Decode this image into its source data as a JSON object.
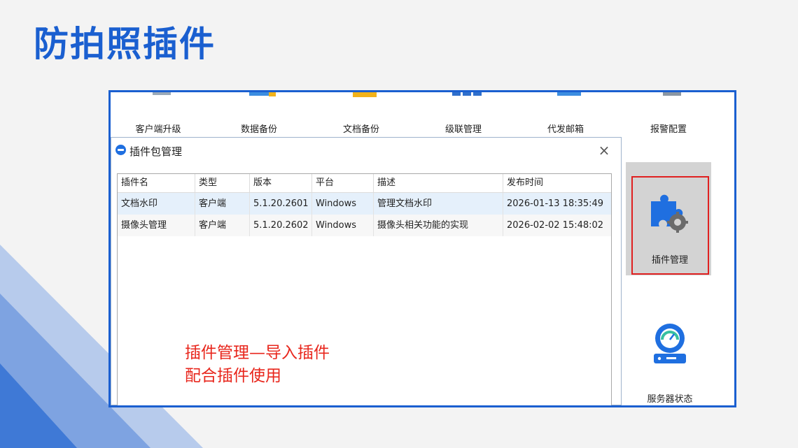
{
  "slide": {
    "title": "防拍照插件"
  },
  "toolbar": {
    "items": [
      {
        "label": "客户端升级",
        "icon": "client-upgrade-icon"
      },
      {
        "label": "数据备份",
        "icon": "data-backup-icon"
      },
      {
        "label": "文档备份",
        "icon": "document-backup-icon"
      },
      {
        "label": "级联管理",
        "icon": "cascade-management-icon"
      },
      {
        "label": "代发邮箱",
        "icon": "mail-relay-icon"
      },
      {
        "label": "报警配置",
        "icon": "alarm-config-icon"
      }
    ]
  },
  "dialog": {
    "title": "插件包管理",
    "close": "×",
    "table": {
      "columns": [
        "插件名",
        "类型",
        "版本",
        "平台",
        "描述",
        "发布时间"
      ],
      "rows": [
        [
          "文档水印",
          "客户端",
          "5.1.20.2601",
          "Windows",
          "管理文档水印",
          "2026-01-13 18:35:49"
        ],
        [
          "摄像头管理",
          "客户端",
          "5.1.20.2602",
          "Windows",
          "摄像头相关功能的实现",
          "2026-02-02 15:48:02"
        ]
      ]
    }
  },
  "right_panel": {
    "plugin_management": {
      "label": "插件管理",
      "icon": "puzzle-gear-icon"
    },
    "server_status": {
      "label": "服务器状态",
      "icon": "server-gauge-icon"
    }
  },
  "annotation": {
    "line1": "插件管理—导入插件",
    "line2": "配合插件使用"
  },
  "colors": {
    "title": "#1a5fd0",
    "frame": "#1a5fd0",
    "annotation": "#e8261c",
    "highlight": "#e02020",
    "selected_row": "#e5f0fb"
  }
}
